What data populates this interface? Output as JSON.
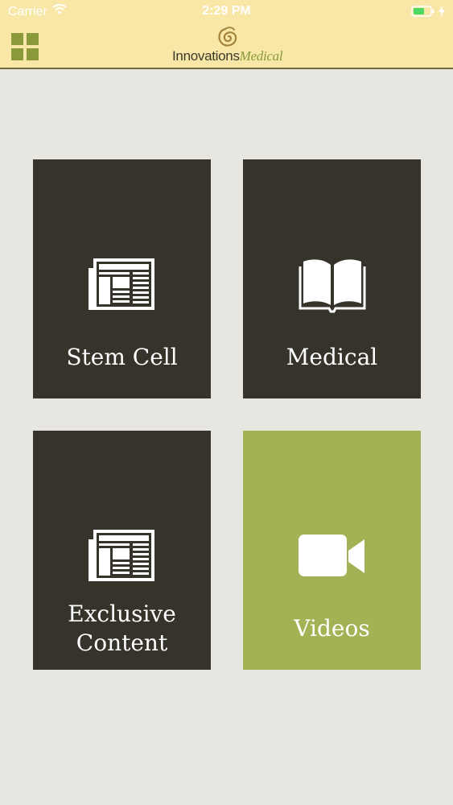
{
  "status_bar": {
    "carrier": "Carrier",
    "time": "2:29 PM",
    "icons": [
      "wifi-icon",
      "battery-icon",
      "charging-icon"
    ],
    "battery_color": "#4CD964"
  },
  "nav": {
    "menu_icon": "grid-icon",
    "logo": {
      "part1": "Innovations",
      "part2": "Medical"
    }
  },
  "colors": {
    "header_bg": "#F8E7A6",
    "page_bg": "#E8E6E1",
    "tile_dark": "#36342A",
    "tile_accent": "#A3B254",
    "logo_green": "#8A9A3A"
  },
  "tiles": [
    {
      "label": "Stem Cell",
      "icon": "newspaper-icon"
    },
    {
      "label": "Medical",
      "icon": "book-icon"
    },
    {
      "label_lines": [
        "Exclusive",
        "Content"
      ],
      "icon": "newspaper-icon"
    },
    {
      "label": "Videos",
      "icon": "video-camera-icon"
    }
  ]
}
